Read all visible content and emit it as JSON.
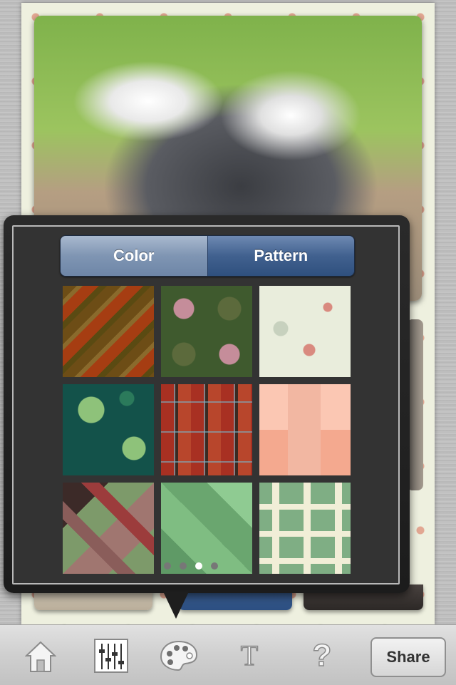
{
  "segmented": {
    "color_label": "Color",
    "pattern_label": "Pattern",
    "selected": "Pattern"
  },
  "patterns": [
    {
      "name": "diagonal-stripes-brown"
    },
    {
      "name": "pink-green-ornamental"
    },
    {
      "name": "cream-floral-vine"
    },
    {
      "name": "teal-hibiscus-floral"
    },
    {
      "name": "red-plaid"
    },
    {
      "name": "peach-blocks"
    },
    {
      "name": "argyle-red-green"
    },
    {
      "name": "green-diamond-argyle"
    },
    {
      "name": "green-cream-maze"
    }
  ],
  "pager": {
    "page_count": 4,
    "current_page": 3
  },
  "toolbar": {
    "icons": [
      "home-icon",
      "equalizer-icon",
      "palette-icon",
      "text-icon",
      "help-icon"
    ],
    "text_icon_glyph": "T",
    "help_icon_glyph": "?",
    "share_label": "Share"
  },
  "colors": {
    "segment_selected": "#41618f",
    "segment_unselected": "#7f95b3",
    "popover_bg": "#333333"
  }
}
